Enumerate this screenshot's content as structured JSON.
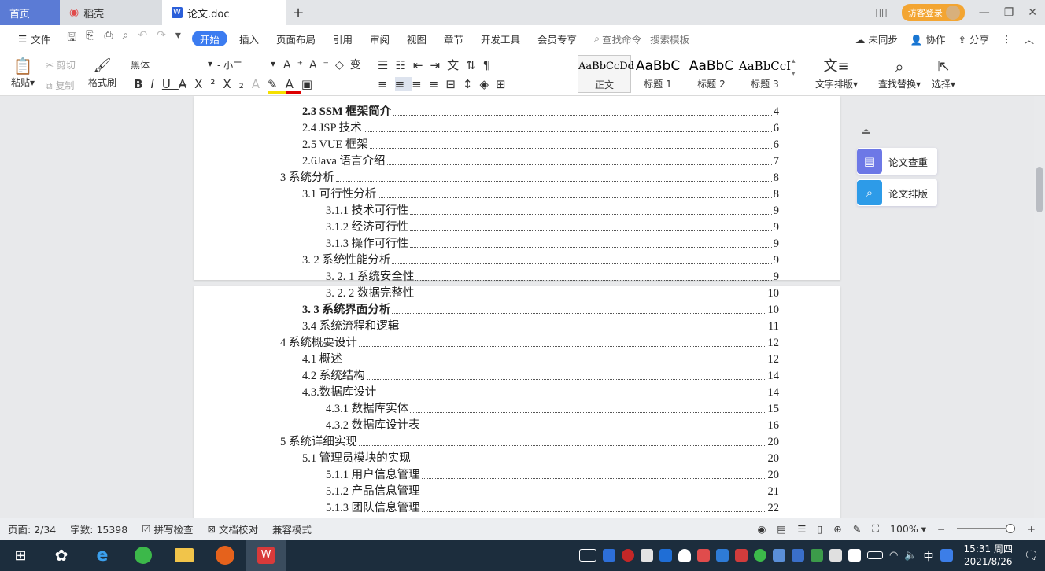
{
  "tabs": [
    {
      "label": "首页"
    },
    {
      "label": "稻壳"
    },
    {
      "label": "论文.doc"
    }
  ],
  "login_label": "访客登录",
  "menu": {
    "file": "文件",
    "items": [
      "开始",
      "插入",
      "页面布局",
      "引用",
      "审阅",
      "视图",
      "章节",
      "开发工具",
      "会员专享"
    ],
    "search_cmd": "查找命令",
    "search_template": "搜索模板",
    "unsync": "未同步",
    "collab": "协作",
    "share": "分享"
  },
  "ribbon": {
    "paste": "粘贴",
    "cut": "剪切",
    "copy": "复制",
    "format_painter": "格式刷",
    "font": "黑体",
    "size": "小二",
    "styles": [
      {
        "preview": "AaBbCcDd",
        "label": "正文"
      },
      {
        "preview": "AaBbC",
        "label": "标题 1"
      },
      {
        "preview": "AaBbC",
        "label": "标题 2"
      },
      {
        "preview": "AaBbCcI",
        "label": "标题 3"
      }
    ],
    "text_layout": "文字排版",
    "find_replace": "查找替换",
    "select": "选择"
  },
  "toc": [
    {
      "text": "2.3 SSM 框架简介",
      "page": "4",
      "level": 2,
      "bold": true
    },
    {
      "text": "2.4 JSP 技术",
      "page": "6",
      "level": 2
    },
    {
      "text": "2.5 VUE 框架",
      "page": "6",
      "level": 2
    },
    {
      "text": "2.6Java 语言介绍",
      "page": "7",
      "level": 2
    },
    {
      "text": "3 系统分析",
      "page": "8",
      "level": 1
    },
    {
      "text": "3.1 可行性分析",
      "page": "8",
      "level": 2
    },
    {
      "text": "3.1.1 技术可行性",
      "page": "9",
      "level": 3
    },
    {
      "text": "3.1.2 经济可行性",
      "page": "9",
      "level": 3
    },
    {
      "text": "3.1.3 操作可行性",
      "page": "9",
      "level": 3
    },
    {
      "text": "3. 2 系统性能分析",
      "page": "9",
      "level": 2
    },
    {
      "text": "3. 2. 1 系统安全性",
      "page": "9",
      "level": 3
    },
    {
      "text": "3. 2. 2 数据完整性",
      "page": "10",
      "level": 3
    },
    {
      "text": "3. 3 系统界面分析",
      "page": "10",
      "level": 2,
      "bold": true
    },
    {
      "text": "3.4 系统流程和逻辑",
      "page": "11",
      "level": 2
    },
    {
      "text": "4 系统概要设计",
      "page": "12",
      "level": 1
    },
    {
      "text": "4.1 概述",
      "page": "12",
      "level": 2
    },
    {
      "text": "4.2 系统结构",
      "page": "14",
      "level": 2
    },
    {
      "text": "4.3.数据库设计",
      "page": "14",
      "level": 2
    },
    {
      "text": "4.3.1 数据库实体",
      "page": "15",
      "level": 3
    },
    {
      "text": "4.3.2 数据库设计表",
      "page": "16",
      "level": 3
    },
    {
      "text": "5 系统详细实现",
      "page": "20",
      "level": 1
    },
    {
      "text": "5.1 管理员模块的实现",
      "page": "20",
      "level": 2
    },
    {
      "text": "5.1.1 用户信息管理",
      "page": "20",
      "level": 3
    },
    {
      "text": "5.1.2 产品信息管理",
      "page": "21",
      "level": 3
    },
    {
      "text": "5.1.3 团队信息管理",
      "page": "22",
      "level": 3
    }
  ],
  "side_panel": {
    "check": "论文查重",
    "layout": "论文排版"
  },
  "status": {
    "page": "页面: 2/34",
    "words": "字数: 15398",
    "spell": "拼写检查",
    "proof": "文档校对",
    "compat": "兼容模式",
    "zoom": "100%"
  },
  "clock": {
    "time": "15:31 周四",
    "date": "2021/8/26"
  },
  "ime": "中"
}
